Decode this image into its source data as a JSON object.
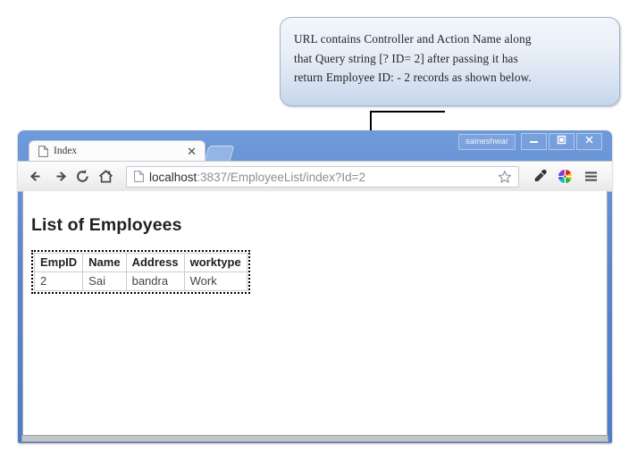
{
  "annotation": {
    "callout_text": "URL contains Controller and Action Name along\nthat Query string [? ID= 2] after passing it has\nreturn Employee ID: - 2 records as shown below.",
    "pointer_icon": "down-arrow-icon"
  },
  "browser": {
    "titlebar": {
      "user_label": "saineshwar",
      "minimize_label": "–",
      "maximize_label": "□",
      "close_label": "✕",
      "minimize_icon": "minimize-icon",
      "maximize_icon": "maximize-icon",
      "close_icon": "close-icon"
    },
    "tab": {
      "title": "Index",
      "favicon": "page-icon",
      "close_label": "✕",
      "new_tab_label": ""
    },
    "toolbar": {
      "back_icon": "back-arrow-icon",
      "forward_icon": "forward-arrow-icon",
      "reload_icon": "reload-icon",
      "home_icon": "home-icon",
      "bookmark_icon": "star-icon",
      "eyedropper_icon": "eyedropper-icon",
      "colorwheel_icon": "color-wheel-icon",
      "menu_icon": "hamburger-menu-icon"
    },
    "address_bar": {
      "favicon": "page-icon",
      "host": "localhost",
      "path": ":3837/EmployeeList/index?Id=2",
      "full_url": "localhost:3837/EmployeeList/index?Id=2",
      "highlight_color": "#d3202a"
    }
  },
  "page": {
    "heading": "List of Employees",
    "table": {
      "columns": [
        "EmpID",
        "Name",
        "Address",
        "worktype"
      ],
      "rows": [
        [
          "2",
          "Sai",
          "bandra",
          "Work"
        ]
      ]
    }
  }
}
